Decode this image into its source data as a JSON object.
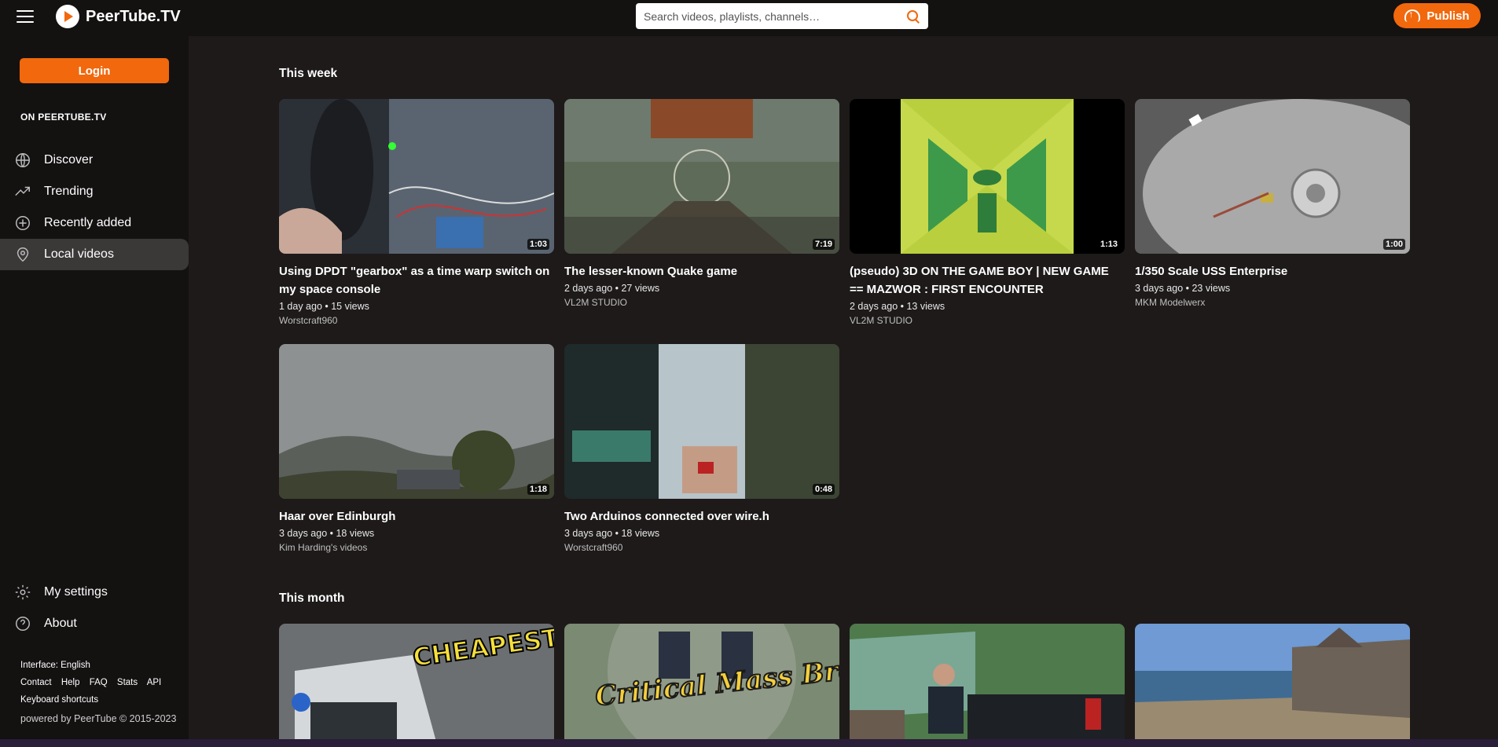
{
  "header": {
    "site_name": "PeerTube.TV",
    "search_placeholder": "Search videos, playlists, channels…",
    "publish_label": "Publish"
  },
  "sidebar": {
    "login_label": "Login",
    "section_heading": "ON PEERTUBE.TV",
    "items": [
      {
        "label": "Discover",
        "icon": "globe-icon"
      },
      {
        "label": "Trending",
        "icon": "trending-icon"
      },
      {
        "label": "Recently added",
        "icon": "plus-circle-icon"
      },
      {
        "label": "Local videos",
        "icon": "location-pin-icon"
      }
    ],
    "bottom_items": [
      {
        "label": "My settings",
        "icon": "gear-icon"
      },
      {
        "label": "About",
        "icon": "help-icon"
      }
    ],
    "footer": {
      "interface": "Interface: English",
      "links": [
        "Contact",
        "Help",
        "FAQ",
        "Stats",
        "API"
      ],
      "shortcuts": "Keyboard shortcuts",
      "powered": "powered by PeerTube © 2015-2023"
    }
  },
  "sections": [
    {
      "title": "This week",
      "videos": [
        {
          "title": "Using DPDT \"gearbox\" as a time warp switch on my space console",
          "meta": "1 day ago • 15 views",
          "channel": "Worstcraft960",
          "duration": "1:03"
        },
        {
          "title": "The lesser-known Quake game",
          "meta": "2 days ago • 27 views",
          "channel": "VL2M STUDIO",
          "duration": "7:19"
        },
        {
          "title": "(pseudo) 3D ON THE GAME BOY | NEW GAME == MAZWOR : FIRST ENCOUNTER",
          "meta": "2 days ago • 13 views",
          "channel": "VL2M STUDIO",
          "duration": "1:13"
        },
        {
          "title": "1/350 Scale USS Enterprise",
          "meta": "3 days ago • 23 views",
          "channel": "MKM Modelwerx",
          "duration": "1:00"
        },
        {
          "title": "Haar over Edinburgh",
          "meta": "3 days ago • 18 views",
          "channel": "Kim Harding's videos",
          "duration": "1:18"
        },
        {
          "title": "Two Arduinos connected over wire.h",
          "meta": "3 days ago • 18 views",
          "channel": "Worstcraft960",
          "duration": "0:48"
        }
      ]
    },
    {
      "title": "This month",
      "videos": [
        {
          "thumb_text": "CHEAPEST HOME BACKUP?"
        },
        {
          "thumb_text": "Critical Mass Bremen"
        },
        {},
        {}
      ]
    }
  ]
}
